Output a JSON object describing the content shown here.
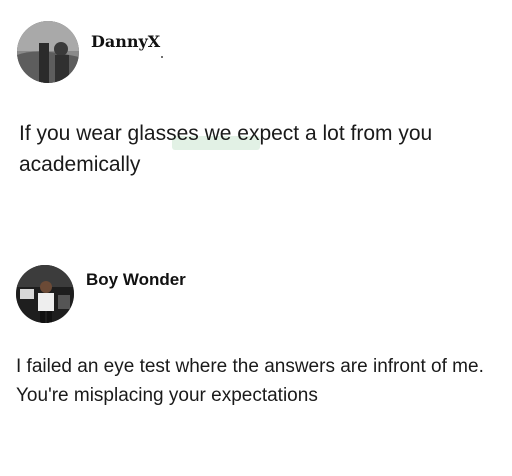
{
  "posts": [
    {
      "author": "DannyX",
      "text": "If you wear glasses we expect a lot from you academically"
    },
    {
      "author": "Boy Wonder",
      "text": "I failed an eye test where the answers are infront of me. You're misplacing your expectations"
    }
  ],
  "colors": {
    "background": "#ffffff",
    "text": "#111111"
  }
}
